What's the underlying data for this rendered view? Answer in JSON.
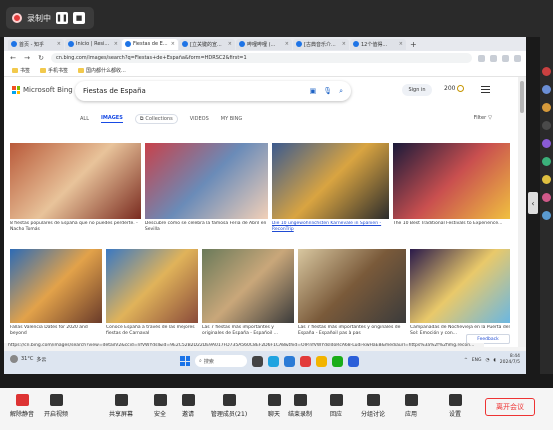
{
  "recording": {
    "label": "录制中",
    "pause": "❚❚",
    "stop": "■"
  },
  "browser": {
    "tabs": [
      {
        "label": "首页 - 知乎",
        "active": false
      },
      {
        "label": "Inicio | Resi...",
        "active": false
      },
      {
        "label": "Fiestas de E...",
        "active": true
      },
      {
        "label": "[立关键的宣...",
        "active": false
      },
      {
        "label": "哔哩哔哩 (...",
        "active": false
      },
      {
        "label": "[古典音乐介...",
        "active": false
      },
      {
        "label": "12个值得...",
        "active": false
      }
    ],
    "address": "cn.bing.com/images/search?q=Fiestas+de+España&form=HDRSC2&first=1",
    "bookmarks": [
      "书签",
      "手机书签",
      "国内都什么都收..."
    ]
  },
  "bing": {
    "logo": "Microsoft Bing",
    "query": "Fiestas de España",
    "signin": "Sign in",
    "points": "200",
    "scopes": [
      "ALL",
      "IMAGES",
      "Collections",
      "VIDEOS",
      "MY BING"
    ],
    "active_scope": "IMAGES",
    "filter": "Filter",
    "row1": [
      {
        "caption": "8 fiestas populares de España que no puedes perderte. - Nacho Tomás",
        "link": false,
        "colors": [
          "#b95a3a",
          "#e8c39a",
          "#7a2b20"
        ]
      },
      {
        "caption": "Descubre cómo se celebra la famosa Feria de Abril en Sevilla",
        "link": false,
        "colors": [
          "#c8414a",
          "#6a8bb8",
          "#f2d0b8"
        ]
      },
      {
        "caption": "Die 10 ungewöhnlichsten Karnevale in Spanien - ReconTrip",
        "link": true,
        "colors": [
          "#3b5a8f",
          "#d9a441",
          "#2c2c2c"
        ]
      },
      {
        "caption": "The 10 Best Traditional Festivals to Experience...",
        "link": false,
        "colors": [
          "#1a1a3a",
          "#c94f4f",
          "#f0c040"
        ]
      }
    ],
    "row2": [
      {
        "caption": "Fallas Valencia Dates for 2020 and beyond",
        "colors": [
          "#2d6bb5",
          "#e2a24a",
          "#6a3b2a"
        ]
      },
      {
        "caption": "Conoce España a través de las mejores fiestas de Carnaval",
        "colors": [
          "#3a78c2",
          "#e0b35a",
          "#8a4b3a"
        ]
      },
      {
        "caption": "Las 7 fiestas más importantes y originales de España - Españoil ...",
        "colors": [
          "#6a7a5a",
          "#c9a77a",
          "#3b3b3b"
        ]
      },
      {
        "caption": "Las 7 fiestas más importantes y originales de España - Españoil pas à pas",
        "colors": [
          "#d8c7a0",
          "#7a5a3a",
          "#3b3b3b"
        ]
      },
      {
        "caption": "Campanadas de Nochevieja en la Puerta del Sol: Emoción y con...",
        "colors": [
          "#2a1a4a",
          "#e9c96a",
          "#6ab7e2"
        ]
      }
    ],
    "feedback": "Feedback",
    "status_url": "https://cn.bing.com/images/search?view=detailV2&ccid=nfVWYdsI&id=9E2C52B2D22DE9A017FD735A560C8EF2D6F1CA8&thid=OIP.nfVWYdsIdoRcA68-Ludi-kwHaE8&mediaurl=https%3a%2f%2fimg.recon..."
  },
  "taskbar": {
    "weather_temp": "31°C",
    "weather_desc": "多云",
    "search": "搜索",
    "lang": "ENG",
    "time": "8:44",
    "date": "2024/7/5"
  },
  "meeting": {
    "controls": [
      "解除静音",
      "开启视频",
      "共享屏幕",
      "安全",
      "邀请",
      "管理成员(21)",
      "聊天",
      "结束录制",
      "回应",
      "分组讨论",
      "应用",
      "设置"
    ],
    "end": "离开会议"
  }
}
